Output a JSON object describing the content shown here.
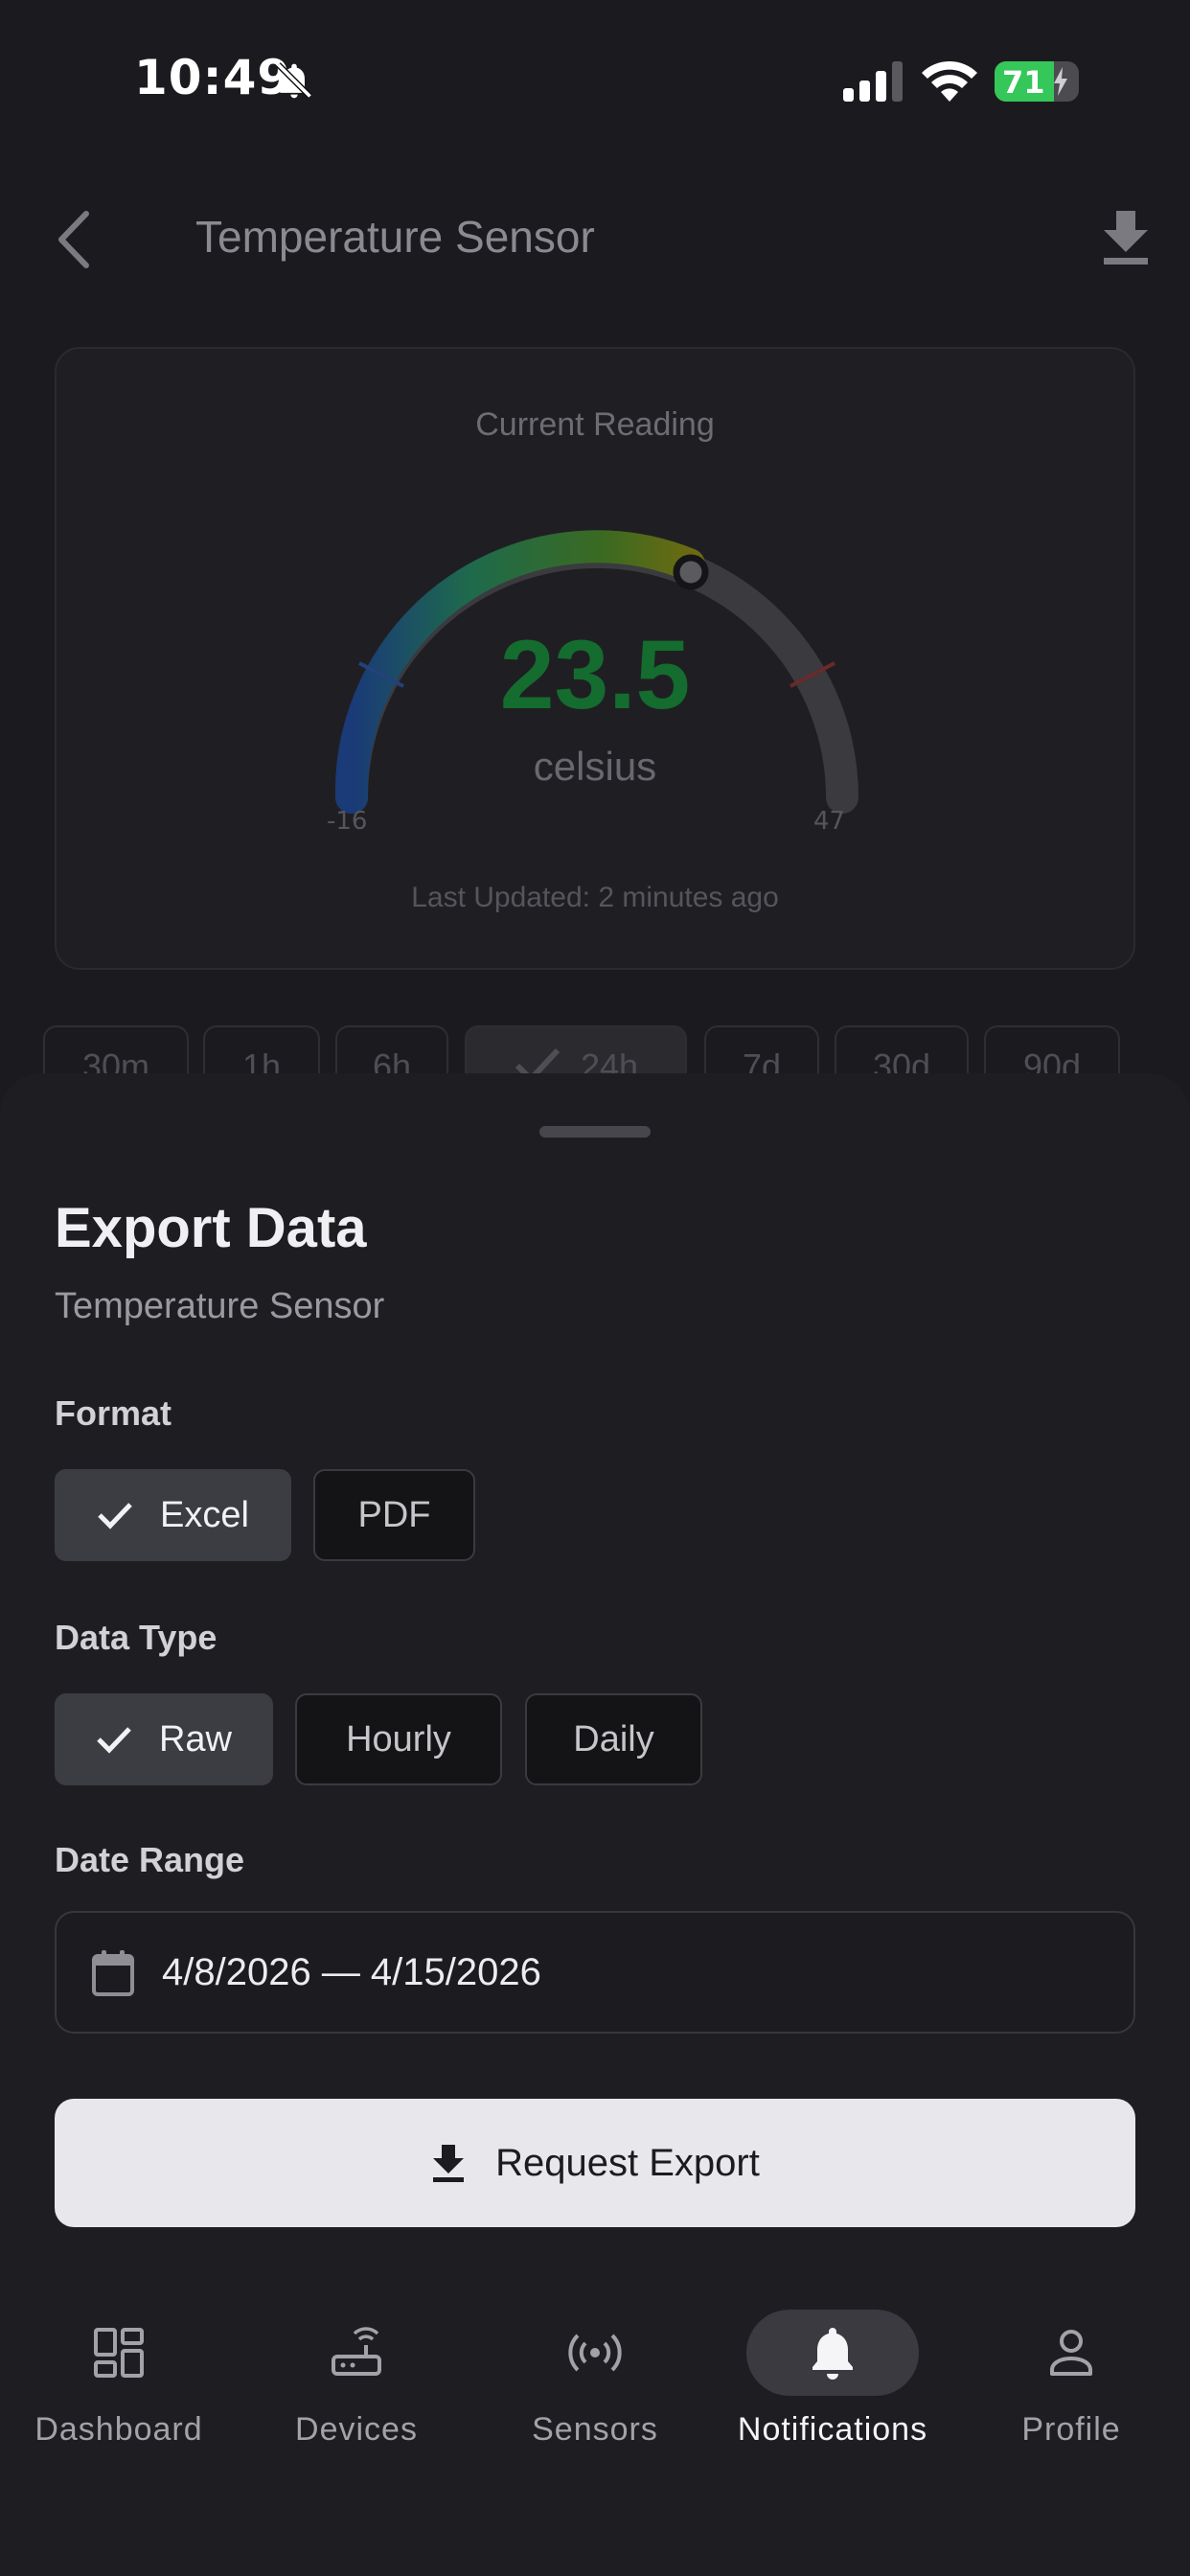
{
  "status_bar": {
    "time": "10:49",
    "battery": "71",
    "battery_level": 0.71
  },
  "header": {
    "title": "Temperature Sensor"
  },
  "reading_card": {
    "title": "Current Reading",
    "value": "23.5",
    "unit": "celsius",
    "min": "-16",
    "max": "47",
    "last_updated": "Last Updated: 2 minutes ago"
  },
  "time_ranges": [
    {
      "label": "30m",
      "selected": false
    },
    {
      "label": "1h",
      "selected": false
    },
    {
      "label": "6h",
      "selected": false
    },
    {
      "label": "24h",
      "selected": true
    },
    {
      "label": "7d",
      "selected": false
    },
    {
      "label": "30d",
      "selected": false
    },
    {
      "label": "90d",
      "selected": false
    }
  ],
  "sheet": {
    "title": "Export Data",
    "subtitle": "Temperature Sensor",
    "format_label": "Format",
    "formats": [
      {
        "label": "Excel",
        "selected": true
      },
      {
        "label": "PDF",
        "selected": false
      }
    ],
    "data_type_label": "Data Type",
    "data_types": [
      {
        "label": "Raw",
        "selected": true
      },
      {
        "label": "Hourly",
        "selected": false
      },
      {
        "label": "Daily",
        "selected": false
      }
    ],
    "date_range_label": "Date Range",
    "date_range_value": "4/8/2026 — 4/15/2026",
    "export_button": "Request Export"
  },
  "tab_bar": {
    "tabs": [
      {
        "label": "Dashboard",
        "icon": "dashboard-icon",
        "active": false
      },
      {
        "label": "Devices",
        "icon": "router-icon",
        "active": false
      },
      {
        "label": "Sensors",
        "icon": "sensor-icon",
        "active": false
      },
      {
        "label": "Notifications",
        "icon": "bell-icon",
        "active": true
      },
      {
        "label": "Profile",
        "icon": "person-icon",
        "active": false
      }
    ]
  },
  "colors": {
    "accent_green": "#146c2e",
    "battery_green": "#35c759",
    "sheet_bg": "#1e1e22",
    "button_bg": "#e8e8ec"
  }
}
